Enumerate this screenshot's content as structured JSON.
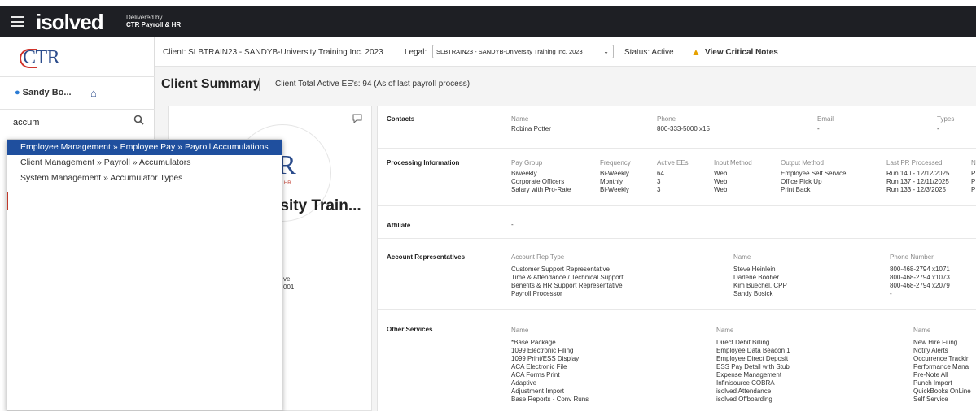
{
  "topbar": {
    "logo": "isolved",
    "delivered_by": "Delivered by",
    "provider": "CTR Payroll & HR"
  },
  "sidebar": {
    "logo_text": "CTR",
    "user": "Sandy Bo...",
    "search_value": "accum"
  },
  "search_results": [
    "Employee Management » Employee Pay » Payroll Accumulations",
    "Client Management » Payroll » Accumulators",
    "System Management » Accumulator Types"
  ],
  "clientbar": {
    "client": "Client: SLBTRAIN23 - SANDYB-University Training Inc. 2023",
    "legal_label": "Legal:",
    "legal_value": "SLBTRAIN23 - SANDYB-University Training Inc. 2023",
    "status": "Status: Active",
    "critical_notes": "View Critical Notes"
  },
  "summary": {
    "title": "Client Summary",
    "subtitle": "Client Total Active EE's: 94 (As of last payroll process)"
  },
  "card": {
    "logo_letter": "R",
    "logo_sub": "oll | HR",
    "name_fragment": "rsity Train...",
    "status_fragment": "ve",
    "id_fragment": "001"
  },
  "contacts": {
    "title": "Contacts",
    "headers": [
      "Name",
      "Phone",
      "Email",
      "Types"
    ],
    "row": [
      "Robina Potter",
      "800-333-5000 x15",
      "-",
      "-"
    ]
  },
  "processing": {
    "title": "Processing Information",
    "headers": [
      "Pay Group",
      "Frequency",
      "Active EEs",
      "Input Method",
      "Output Method",
      "Last PR Processed",
      "N"
    ],
    "rows": [
      [
        "Biweekly",
        "Bi-Weekly",
        "64",
        "Web",
        "Employee Self Service",
        "Run 140 - 12/12/2025",
        "P"
      ],
      [
        "Corporate Officers",
        "Monthly",
        "3",
        "Web",
        "Office Pick Up",
        "Run 137 - 12/11/2025",
        "P"
      ],
      [
        "Salary with Pro-Rate",
        "Bi-Weekly",
        "3",
        "Web",
        "Print Back",
        "Run 133 - 12/3/2025",
        "P"
      ]
    ]
  },
  "affiliate": {
    "title": "Affiliate",
    "value": "-"
  },
  "account_reps": {
    "title": "Account Representatives",
    "headers": [
      "Account Rep Type",
      "Name",
      "Phone Number"
    ],
    "rows": [
      [
        "Customer Support Representative",
        "Steve Heinlein",
        "800-468-2794 x1071"
      ],
      [
        "Time & Attendance / Technical Support",
        "Darlene Booher",
        "800-468-2794 x1073"
      ],
      [
        "Benefits & HR Support Representative",
        "Kim Buechel, CPP",
        "800-468-2794 x2079"
      ],
      [
        "Payroll Processor",
        "Sandy Bosick",
        "-"
      ]
    ]
  },
  "other_services": {
    "title": "Other Services",
    "header": "Name",
    "col1": [
      "*Base Package",
      "1099 Electronic Filing",
      "1099 Print/ESS Display",
      "ACA Electronic File",
      "ACA Forms Print",
      "Adaptive",
      "Adjustment Import",
      "Base Reports - Conv Runs"
    ],
    "col2": [
      "Direct Debit Billing",
      "Employee Data Beacon 1",
      "Employee Direct Deposit",
      "ESS Pay Detail with Stub",
      "Expense Management",
      "Infinisource COBRA",
      "isolved Attendance",
      "isolved Offboarding"
    ],
    "col3": [
      "New Hire Filing",
      "Notify Alerts",
      "Occurrence Trackin",
      "Performance Mana",
      "Pre-Note All",
      "Punch Import",
      "QuickBooks OnLine",
      "Self Service"
    ]
  }
}
